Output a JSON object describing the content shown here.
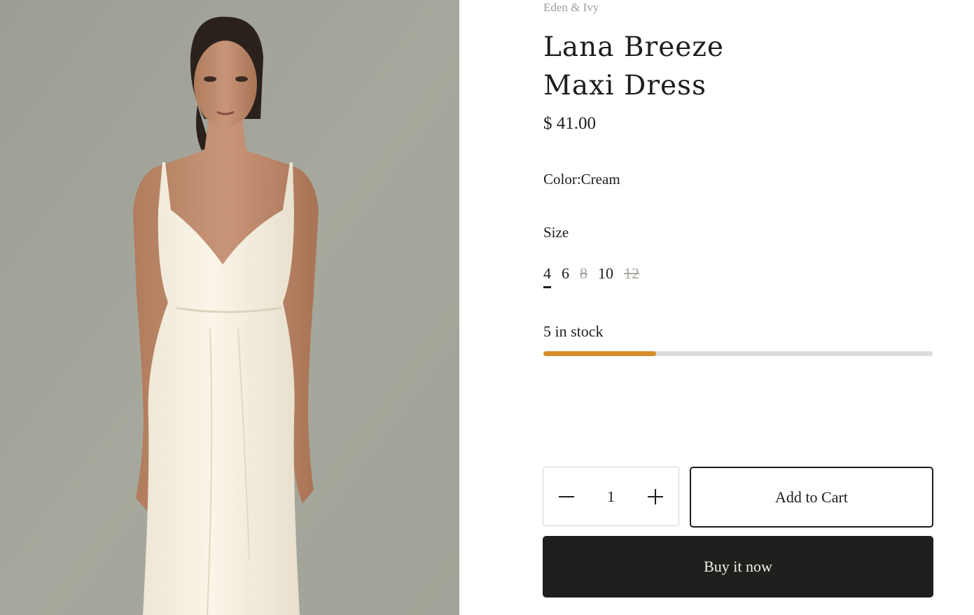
{
  "product": {
    "vendor": "Eden & Ivy",
    "title_line1": "Lana Breeze",
    "title_line2": "Maxi Dress",
    "price": "$ 41.00",
    "image_alt": "Model wearing cream maxi dress"
  },
  "color": {
    "label": "Color:",
    "value": "Cream"
  },
  "size": {
    "label": "Size",
    "options": [
      {
        "label": "4",
        "selected": true,
        "available": true
      },
      {
        "label": "6",
        "selected": false,
        "available": true
      },
      {
        "label": "8",
        "selected": false,
        "available": false
      },
      {
        "label": "10",
        "selected": false,
        "available": true
      },
      {
        "label": "12",
        "selected": false,
        "available": false
      }
    ]
  },
  "stock": {
    "text": "5 in stock",
    "fill_fraction": 0.29,
    "fill_color": "#d78e2a",
    "track_color": "#dcdcdc"
  },
  "quantity": {
    "value": "1",
    "decrease_icon": "minus-icon",
    "increase_icon": "plus-icon"
  },
  "actions": {
    "add_to_cart": "Add to Cart",
    "buy_now": "Buy it now"
  },
  "colors": {
    "primary": "#1f1f1d",
    "muted": "#a29d96",
    "accent": "#d78e2a"
  }
}
